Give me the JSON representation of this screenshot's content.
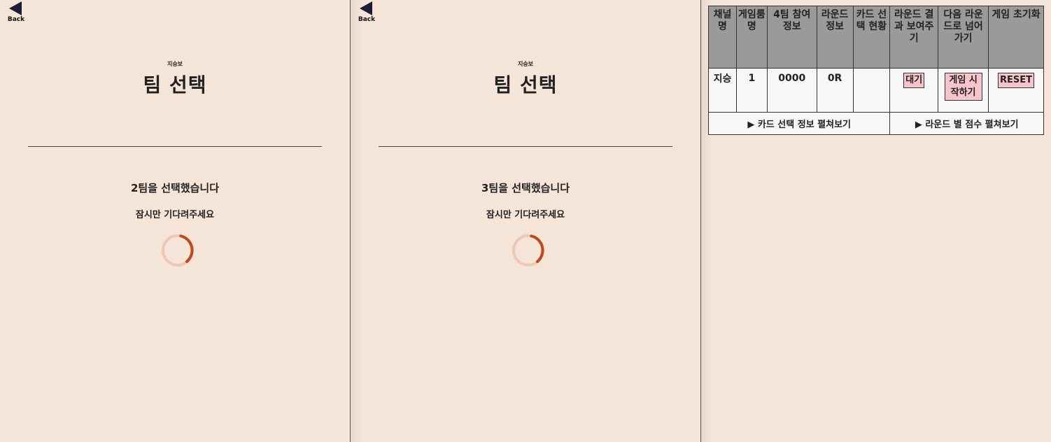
{
  "panels": [
    {
      "back_label": "Back",
      "user_name": "지승보",
      "title": "팀 선택",
      "selected_message": "2팀을 선택했습니다",
      "wait_message": "잠시만 기다려주세요"
    },
    {
      "back_label": "Back",
      "user_name": "지승보",
      "title": "팀 선택",
      "selected_message": "3팀을 선택했습니다",
      "wait_message": "잠시만 기다려주세요"
    }
  ],
  "admin_table": {
    "headers": {
      "channel": "채널명",
      "room": "게임룸명",
      "team4_info": "4팀 참여 정보",
      "round_info": "라운드 정보",
      "card_status": "카드 선택 현황",
      "show_result": "라운드 결과 보여주기",
      "next_round": "다음 라운드로 넘어가기",
      "reset_game": "게임 초기화"
    },
    "row": {
      "channel": "지승",
      "room": "1",
      "team4_info": "0000",
      "round_info": "0R",
      "card_status": "",
      "show_result_button": "대기",
      "next_round_button": "게임 시작하기",
      "reset_button": "RESET"
    },
    "footer": {
      "card_info_toggle": "▶ 카드 선택 정보 펼쳐보기",
      "round_score_toggle": "▶ 라운드 별 점수 펼쳐보기"
    }
  },
  "colors": {
    "background": "#f5e4d8",
    "spinner_track": "#ecc9b5",
    "spinner_arc": "#c04a1c",
    "header_bg": "#9a9a9a",
    "button_pink": "#f7c3cc"
  }
}
